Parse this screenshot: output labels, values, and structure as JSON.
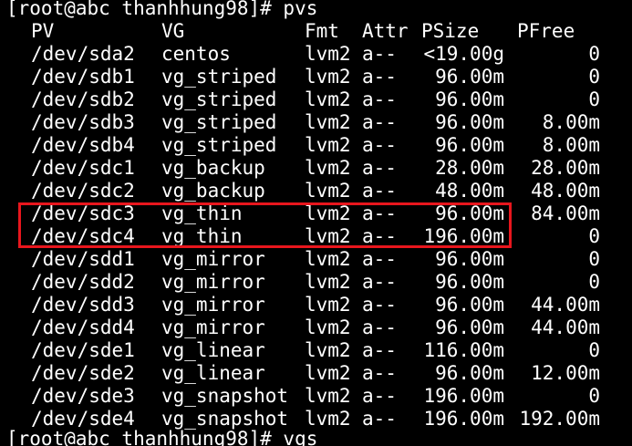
{
  "terminal": {
    "prompt_command": "[root@abc thanhhung98]# pvs",
    "next_prompt": "[root@abc thanhhung98]# vgs",
    "headers": {
      "pv": "PV",
      "vg": "VG",
      "fmt": "Fmt",
      "attr": "Attr",
      "psize": "PSize",
      "pfree": "PFree"
    },
    "rows": [
      {
        "pv": "/dev/sda2",
        "vg": "centos",
        "fmt": "lvm2",
        "attr": "a--",
        "psize": "<19.00g",
        "pfree": "0"
      },
      {
        "pv": "/dev/sdb1",
        "vg": "vg_striped",
        "fmt": "lvm2",
        "attr": "a--",
        "psize": "96.00m",
        "pfree": "0"
      },
      {
        "pv": "/dev/sdb2",
        "vg": "vg_striped",
        "fmt": "lvm2",
        "attr": "a--",
        "psize": "96.00m",
        "pfree": "0"
      },
      {
        "pv": "/dev/sdb3",
        "vg": "vg_striped",
        "fmt": "lvm2",
        "attr": "a--",
        "psize": "96.00m",
        "pfree": "8.00m"
      },
      {
        "pv": "/dev/sdb4",
        "vg": "vg_striped",
        "fmt": "lvm2",
        "attr": "a--",
        "psize": "96.00m",
        "pfree": "8.00m"
      },
      {
        "pv": "/dev/sdc1",
        "vg": "vg_backup",
        "fmt": "lvm2",
        "attr": "a--",
        "psize": "28.00m",
        "pfree": "28.00m"
      },
      {
        "pv": "/dev/sdc2",
        "vg": "vg_backup",
        "fmt": "lvm2",
        "attr": "a--",
        "psize": "48.00m",
        "pfree": "48.00m"
      },
      {
        "pv": "/dev/sdc3",
        "vg": "vg_thin",
        "fmt": "lvm2",
        "attr": "a--",
        "psize": "96.00m",
        "pfree": "84.00m"
      },
      {
        "pv": "/dev/sdc4",
        "vg": "vg_thin",
        "fmt": "lvm2",
        "attr": "a--",
        "psize": "196.00m",
        "pfree": "0"
      },
      {
        "pv": "/dev/sdd1",
        "vg": "vg_mirror",
        "fmt": "lvm2",
        "attr": "a--",
        "psize": "96.00m",
        "pfree": "0"
      },
      {
        "pv": "/dev/sdd2",
        "vg": "vg_mirror",
        "fmt": "lvm2",
        "attr": "a--",
        "psize": "96.00m",
        "pfree": "0"
      },
      {
        "pv": "/dev/sdd3",
        "vg": "vg_mirror",
        "fmt": "lvm2",
        "attr": "a--",
        "psize": "96.00m",
        "pfree": "44.00m"
      },
      {
        "pv": "/dev/sdd4",
        "vg": "vg_mirror",
        "fmt": "lvm2",
        "attr": "a--",
        "psize": "96.00m",
        "pfree": "44.00m"
      },
      {
        "pv": "/dev/sde1",
        "vg": "vg_linear",
        "fmt": "lvm2",
        "attr": "a--",
        "psize": "116.00m",
        "pfree": "0"
      },
      {
        "pv": "/dev/sde2",
        "vg": "vg_linear",
        "fmt": "lvm2",
        "attr": "a--",
        "psize": "96.00m",
        "pfree": "12.00m"
      },
      {
        "pv": "/dev/sde3",
        "vg": "vg_snapshot",
        "fmt": "lvm2",
        "attr": "a--",
        "psize": "196.00m",
        "pfree": "0"
      },
      {
        "pv": "/dev/sde4",
        "vg": "vg_snapshot",
        "fmt": "lvm2",
        "attr": "a--",
        "psize": "196.00m",
        "pfree": "192.00m"
      }
    ]
  },
  "colors": {
    "background": "#000000",
    "foreground": "#ffffff",
    "highlight_border": "#e8161d"
  }
}
